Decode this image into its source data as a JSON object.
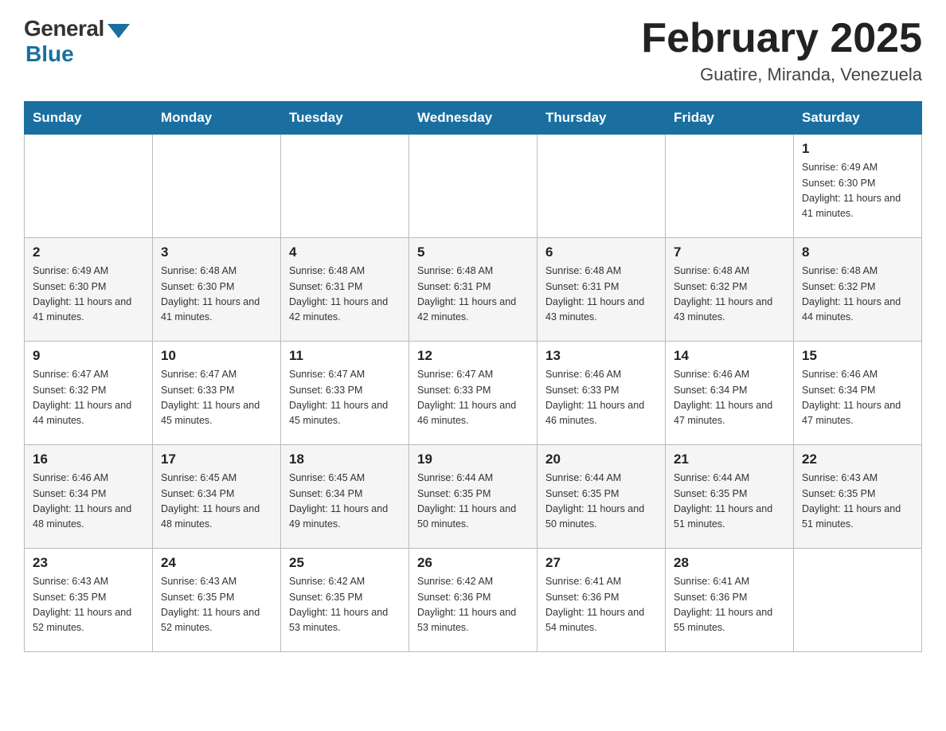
{
  "header": {
    "logo_general": "General",
    "logo_blue": "Blue",
    "month_title": "February 2025",
    "location": "Guatire, Miranda, Venezuela"
  },
  "weekdays": [
    "Sunday",
    "Monday",
    "Tuesday",
    "Wednesday",
    "Thursday",
    "Friday",
    "Saturday"
  ],
  "weeks": [
    [
      {
        "day": "",
        "info": ""
      },
      {
        "day": "",
        "info": ""
      },
      {
        "day": "",
        "info": ""
      },
      {
        "day": "",
        "info": ""
      },
      {
        "day": "",
        "info": ""
      },
      {
        "day": "",
        "info": ""
      },
      {
        "day": "1",
        "info": "Sunrise: 6:49 AM\nSunset: 6:30 PM\nDaylight: 11 hours and 41 minutes."
      }
    ],
    [
      {
        "day": "2",
        "info": "Sunrise: 6:49 AM\nSunset: 6:30 PM\nDaylight: 11 hours and 41 minutes."
      },
      {
        "day": "3",
        "info": "Sunrise: 6:48 AM\nSunset: 6:30 PM\nDaylight: 11 hours and 41 minutes."
      },
      {
        "day": "4",
        "info": "Sunrise: 6:48 AM\nSunset: 6:31 PM\nDaylight: 11 hours and 42 minutes."
      },
      {
        "day": "5",
        "info": "Sunrise: 6:48 AM\nSunset: 6:31 PM\nDaylight: 11 hours and 42 minutes."
      },
      {
        "day": "6",
        "info": "Sunrise: 6:48 AM\nSunset: 6:31 PM\nDaylight: 11 hours and 43 minutes."
      },
      {
        "day": "7",
        "info": "Sunrise: 6:48 AM\nSunset: 6:32 PM\nDaylight: 11 hours and 43 minutes."
      },
      {
        "day": "8",
        "info": "Sunrise: 6:48 AM\nSunset: 6:32 PM\nDaylight: 11 hours and 44 minutes."
      }
    ],
    [
      {
        "day": "9",
        "info": "Sunrise: 6:47 AM\nSunset: 6:32 PM\nDaylight: 11 hours and 44 minutes."
      },
      {
        "day": "10",
        "info": "Sunrise: 6:47 AM\nSunset: 6:33 PM\nDaylight: 11 hours and 45 minutes."
      },
      {
        "day": "11",
        "info": "Sunrise: 6:47 AM\nSunset: 6:33 PM\nDaylight: 11 hours and 45 minutes."
      },
      {
        "day": "12",
        "info": "Sunrise: 6:47 AM\nSunset: 6:33 PM\nDaylight: 11 hours and 46 minutes."
      },
      {
        "day": "13",
        "info": "Sunrise: 6:46 AM\nSunset: 6:33 PM\nDaylight: 11 hours and 46 minutes."
      },
      {
        "day": "14",
        "info": "Sunrise: 6:46 AM\nSunset: 6:34 PM\nDaylight: 11 hours and 47 minutes."
      },
      {
        "day": "15",
        "info": "Sunrise: 6:46 AM\nSunset: 6:34 PM\nDaylight: 11 hours and 47 minutes."
      }
    ],
    [
      {
        "day": "16",
        "info": "Sunrise: 6:46 AM\nSunset: 6:34 PM\nDaylight: 11 hours and 48 minutes."
      },
      {
        "day": "17",
        "info": "Sunrise: 6:45 AM\nSunset: 6:34 PM\nDaylight: 11 hours and 48 minutes."
      },
      {
        "day": "18",
        "info": "Sunrise: 6:45 AM\nSunset: 6:34 PM\nDaylight: 11 hours and 49 minutes."
      },
      {
        "day": "19",
        "info": "Sunrise: 6:44 AM\nSunset: 6:35 PM\nDaylight: 11 hours and 50 minutes."
      },
      {
        "day": "20",
        "info": "Sunrise: 6:44 AM\nSunset: 6:35 PM\nDaylight: 11 hours and 50 minutes."
      },
      {
        "day": "21",
        "info": "Sunrise: 6:44 AM\nSunset: 6:35 PM\nDaylight: 11 hours and 51 minutes."
      },
      {
        "day": "22",
        "info": "Sunrise: 6:43 AM\nSunset: 6:35 PM\nDaylight: 11 hours and 51 minutes."
      }
    ],
    [
      {
        "day": "23",
        "info": "Sunrise: 6:43 AM\nSunset: 6:35 PM\nDaylight: 11 hours and 52 minutes."
      },
      {
        "day": "24",
        "info": "Sunrise: 6:43 AM\nSunset: 6:35 PM\nDaylight: 11 hours and 52 minutes."
      },
      {
        "day": "25",
        "info": "Sunrise: 6:42 AM\nSunset: 6:35 PM\nDaylight: 11 hours and 53 minutes."
      },
      {
        "day": "26",
        "info": "Sunrise: 6:42 AM\nSunset: 6:36 PM\nDaylight: 11 hours and 53 minutes."
      },
      {
        "day": "27",
        "info": "Sunrise: 6:41 AM\nSunset: 6:36 PM\nDaylight: 11 hours and 54 minutes."
      },
      {
        "day": "28",
        "info": "Sunrise: 6:41 AM\nSunset: 6:36 PM\nDaylight: 11 hours and 55 minutes."
      },
      {
        "day": "",
        "info": ""
      }
    ]
  ]
}
